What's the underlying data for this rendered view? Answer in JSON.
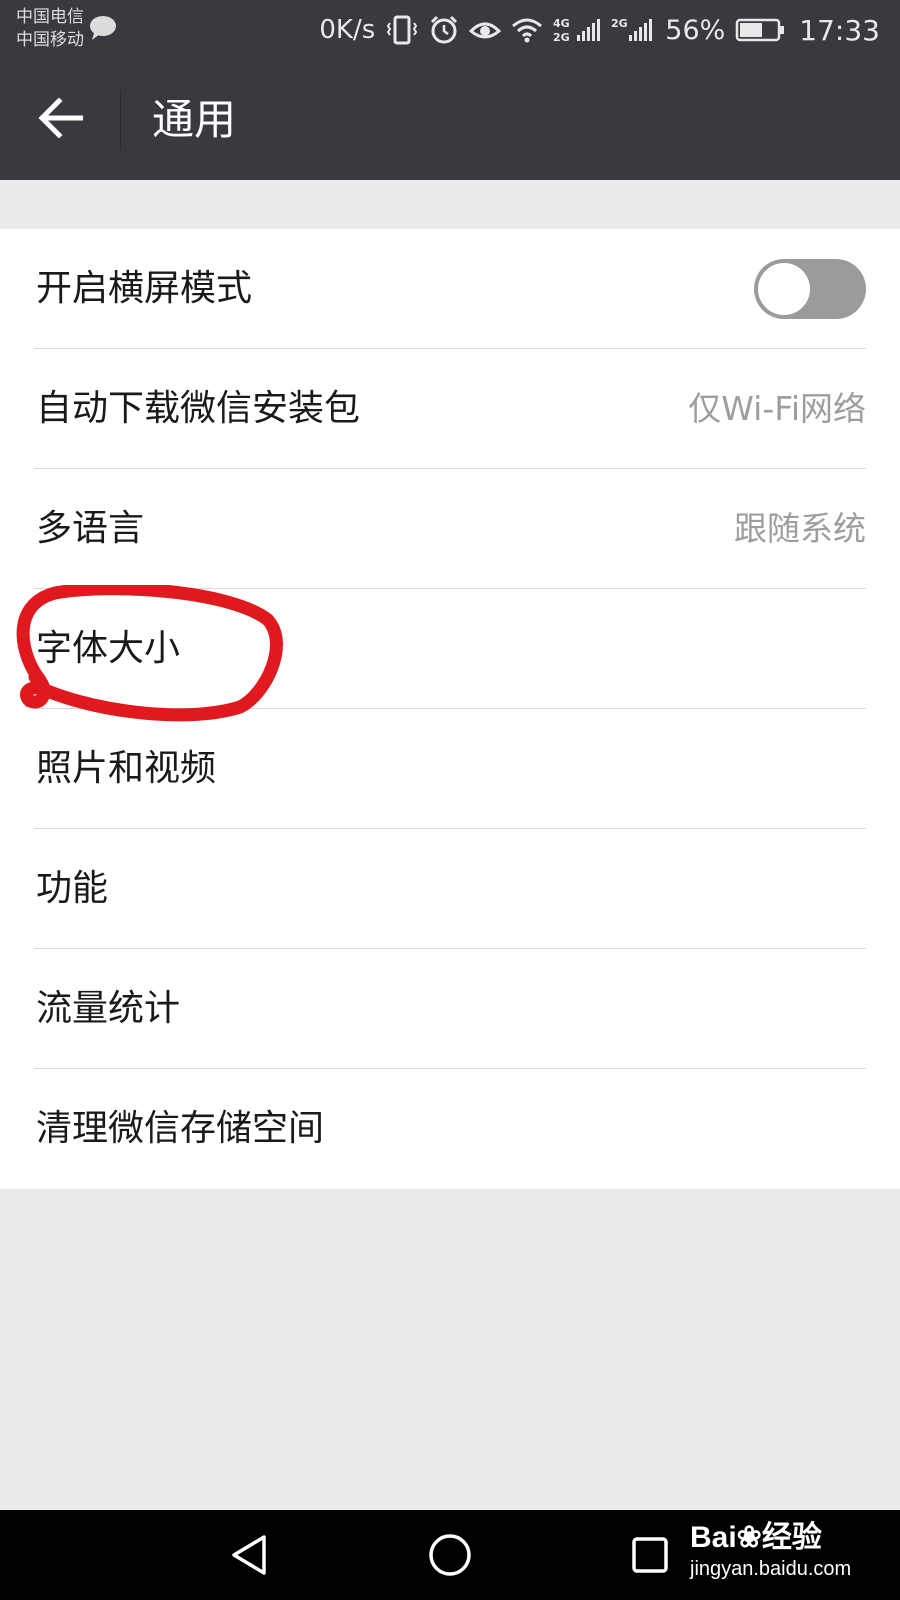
{
  "status_bar": {
    "carrier_1": "中国电信",
    "carrier_2": "中国移动",
    "net_speed": "0K/s",
    "battery_percent": "56%",
    "time": "17:33",
    "icons": [
      "chat-bubble-icon",
      "vibrate-icon",
      "alarm-icon",
      "eye-comfort-icon",
      "wifi-icon",
      "signal-4g-icon",
      "signal-2g-icon",
      "battery-icon"
    ],
    "signal_labels": {
      "sim1_top": "4G",
      "sim1_bottom": "2G",
      "sim2": "2G"
    }
  },
  "header": {
    "title": "通用",
    "back_icon": "arrow-left-icon"
  },
  "settings": {
    "landscape_mode": {
      "label": "开启横屏模式",
      "toggle_on": false
    },
    "auto_download": {
      "label": "自动下载微信安装包",
      "value": "仅Wi-Fi网络"
    },
    "language": {
      "label": "多语言",
      "value": "跟随系统"
    },
    "font_size": {
      "label": "字体大小"
    },
    "photos_videos": {
      "label": "照片和视频"
    },
    "features": {
      "label": "功能"
    },
    "data_usage": {
      "label": "流量统计"
    },
    "storage": {
      "label": "清理微信存储空间"
    }
  },
  "annotation": {
    "color": "#e0191e"
  },
  "nav_bar": {
    "icons": [
      "nav-back-icon",
      "nav-home-icon",
      "nav-recents-icon"
    ]
  },
  "watermark": {
    "logo": "Bai❀经验",
    "url": "jingyan.baidu.com"
  },
  "colors": {
    "header_bg": "#393a3f",
    "page_bg": "#ebebeb",
    "toggle_off": "#9b9b9b"
  }
}
